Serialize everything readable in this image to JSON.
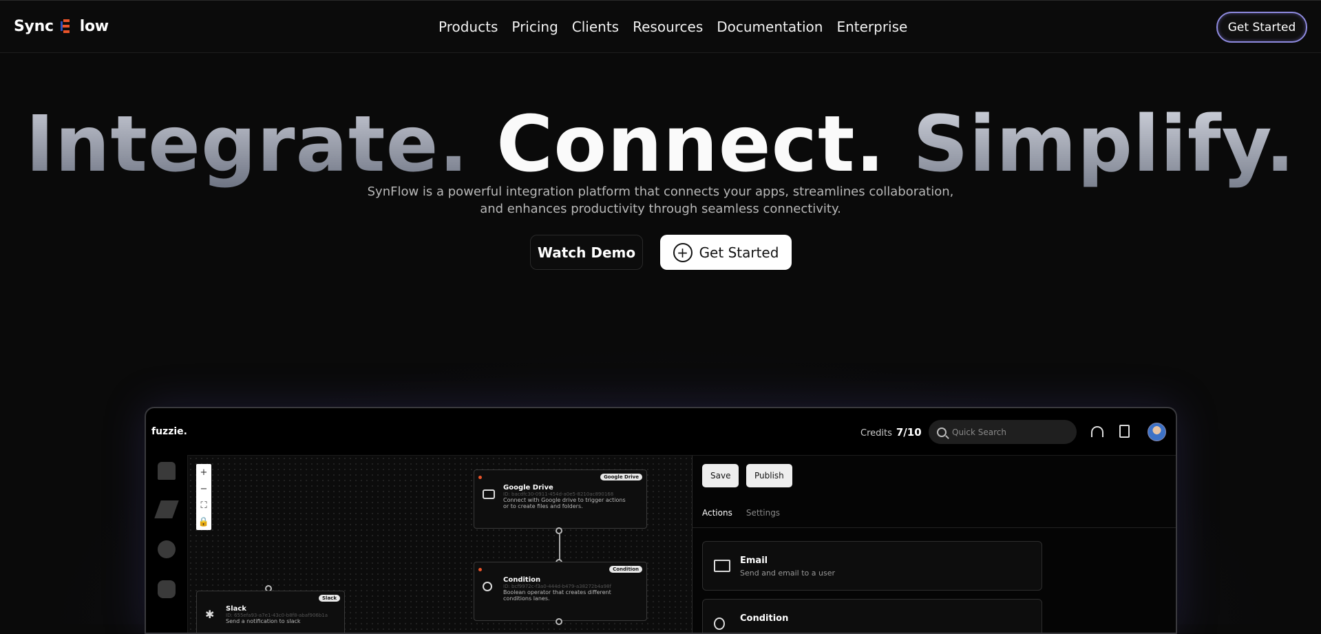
{
  "brand": {
    "left": "Sync",
    "right": "low"
  },
  "nav": [
    "Products",
    "Pricing",
    "Clients",
    "Resources",
    "Documentation",
    "Enterprise"
  ],
  "top_cta": "Get Started",
  "hero": {
    "word1": "Integrate.",
    "word2": "Connect.",
    "word3": "Simplify.",
    "sub_line1": "SynFlow is a powerful integration platform that connects your apps, streamlines collaboration,",
    "sub_line2": "and enhances productivity through seamless connectivity.",
    "demo_button": "Watch Demo",
    "start_button": "Get Started"
  },
  "app": {
    "logo": "fuzzie.",
    "credits_label": "Credits",
    "credits_value": "7/10",
    "search_placeholder": "Quick Search",
    "zoom": [
      "+",
      "−",
      "⛶",
      "🔒"
    ],
    "nodes": {
      "gdrive": {
        "title": "Google Drive",
        "tag": "Google Drive",
        "id": "ID: bacdfc30-0911-454d-a0e5-8210ac890168",
        "desc1": "Connect with Google drive to trigger actions",
        "desc2": "or to create files and folders."
      },
      "condition": {
        "title": "Condition",
        "tag": "Condition",
        "id": "ID: bcf9972c-f3a0-444d-b479-a38272b4a98f",
        "desc1": "Boolean operator that creates different",
        "desc2": "conditions lanes."
      },
      "slack": {
        "title": "Slack",
        "tag": "Slack",
        "id": "ID: 655efa93-a7e1-43c0-b8f8-abaf906b1a",
        "desc1": "Send a notification to slack"
      }
    },
    "panel": {
      "save": "Save",
      "publish": "Publish",
      "tab_actions": "Actions",
      "tab_settings": "Settings",
      "cards": [
        {
          "title": "Email",
          "desc": "Send and email to a user"
        },
        {
          "title": "Condition",
          "desc": ""
        }
      ]
    }
  }
}
